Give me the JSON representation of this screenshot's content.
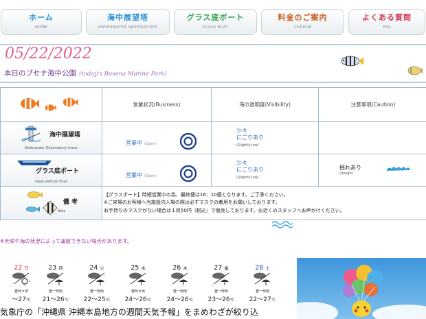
{
  "nav": [
    {
      "label": "ホーム",
      "sub": "HOME",
      "color": "#2b8fd6"
    },
    {
      "label": "海中展望塔",
      "sub": "UNDERWATER OBSERVATORY",
      "color": "#2b8fd6"
    },
    {
      "label": "グラス底ボート",
      "sub": "GLASS BOAT",
      "color": "#2fa24a"
    },
    {
      "label": "料金のご案内",
      "sub": "CHARGE",
      "color": "#c75a1a"
    },
    {
      "label": "よくある質問",
      "sub": "FAQ",
      "color": "#d8344f"
    }
  ],
  "page": {
    "date": "05/22/2022",
    "subtitle_jp": "本日のブセナ海中公園",
    "subtitle_en": "(today's Busena Marine Park)",
    "footnote": "※天候や海の状況によって運航できない場合があります。",
    "bottom_text": "気象庁の「沖縄県 沖縄本島地方の週間天気予報」をまめわざが絞り込"
  },
  "table": {
    "headers": [
      "営業状況(Business)",
      "海の透明度(Visibility)",
      "注意事項(Caution)"
    ],
    "rows": [
      {
        "name": "海中展望塔",
        "name_en": "Underwater Observatory tower",
        "business": "営業中",
        "business_en": "(Open)",
        "visibility_line1": "少々",
        "visibility_line2": "にごりあり",
        "visibility_en": "(Slightly low)",
        "caution": "",
        "caution_en": ""
      },
      {
        "name": "グラス底ボート",
        "name_en": "Glass-bottom Boat",
        "business": "営業中",
        "business_en": "(Open)",
        "visibility_line1": "少々",
        "visibility_line2": "にごりあり",
        "visibility_en": "(Slightly low)",
        "caution": "揺れあり",
        "caution_en": "(Rough)"
      }
    ],
    "note_label": "備 考",
    "note_label_en": "Note",
    "notes": [
      "【グラスボート】時短営業中の為、最終便は16：10便となります。ご了承ください。",
      "※ご来場のお客様へ当施設内入場の際は必ずマスクの着用をお願いしております。",
      "お手持ちのマスクがない場合は１枚50円（税込）で販売しております。お近くのスタッフへお声かけください。"
    ]
  },
  "weather": [
    {
      "day": "22",
      "dow": "日",
      "icon": "cloudy-sunny-icon",
      "desc": "曇時々晴",
      "temp": "〜27",
      "dayColor": "#e03030"
    },
    {
      "day": "23",
      "dow": "月",
      "icon": "cloudy-rain-icon",
      "desc": "曇一時雨",
      "temp": "21〜26",
      "dayColor": "#222222"
    },
    {
      "day": "24",
      "dow": "火",
      "icon": "cloudy-rain-icon",
      "desc": "曇一時雨",
      "temp": "22〜25",
      "dayColor": "#222222"
    },
    {
      "day": "25",
      "dow": "水",
      "icon": "cloudy-rain-icon",
      "desc": "曇時々雨",
      "temp": "24〜26",
      "dayColor": "#222222"
    },
    {
      "day": "26",
      "dow": "木",
      "icon": "cloudy-rain-icon",
      "desc": "曇一時雨",
      "temp": "24〜26",
      "dayColor": "#222222"
    },
    {
      "day": "27",
      "dow": "金",
      "icon": "cloudy-rain-icon",
      "desc": "曇一時雨",
      "temp": "23〜26",
      "dayColor": "#222222"
    },
    {
      "day": "28",
      "dow": "土",
      "icon": "cloudy-rain-icon",
      "desc": "曇一時雨",
      "temp": "22〜27",
      "dayColor": "#2a55c9"
    }
  ],
  "temp_unit": "℃",
  "colors": {
    "accent": "#e0608a",
    "border": "#9fb7cc",
    "status_blue": "#2a6db0",
    "wave": "#3da3d8"
  }
}
